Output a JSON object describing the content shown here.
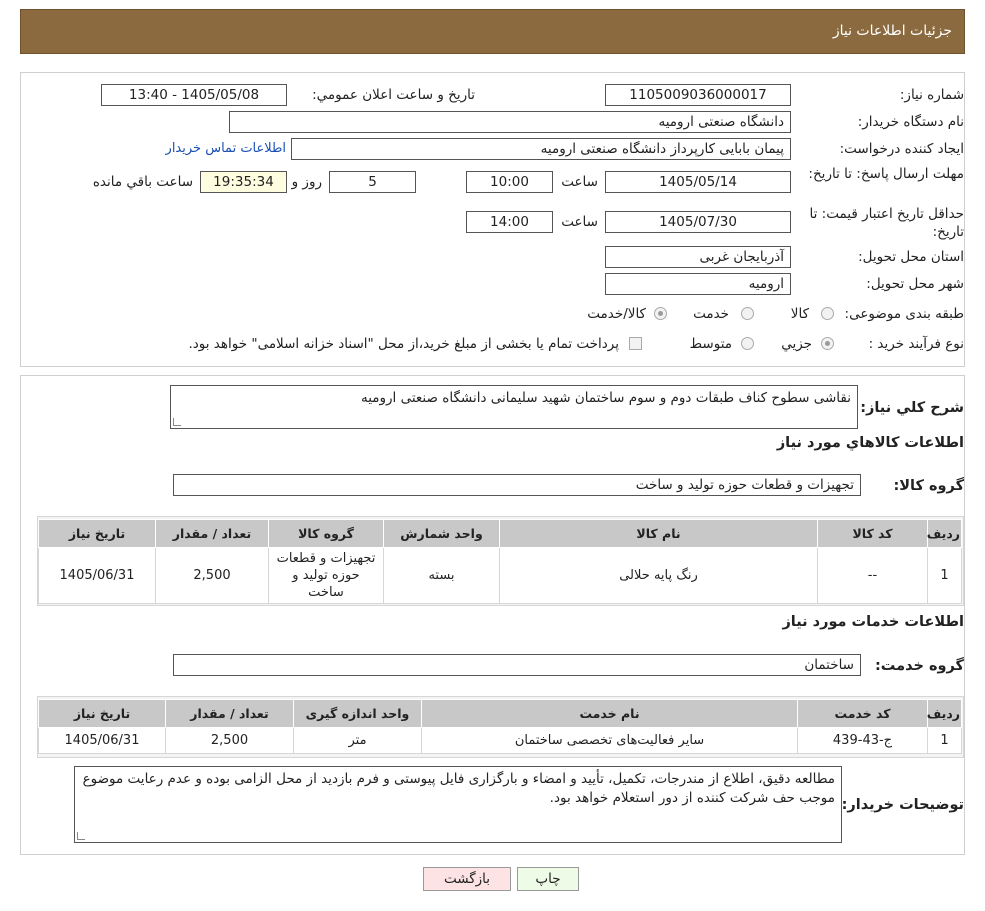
{
  "header": {
    "title": "جزئیات اطلاعات نیاز"
  },
  "form": {
    "need_number_label": "شماره نیاز:",
    "need_number": "1105009036000017",
    "announce_label": "تاریخ و ساعت اعلان عمومي:",
    "announce_value": "1405/05/08 - 13:40",
    "buyer_org_label": "نام دستگاه خریدار:",
    "buyer_org": "دانشگاه صنعتی ارومیه",
    "requester_label": "ایجاد کننده درخواست:",
    "requester": "پیمان بابایی کارپرداز دانشگاه صنعتی ارومیه",
    "contact_link": "اطلاعات تماس خریدار",
    "deadline_label": "مهلت ارسال پاسخ: تا تاریخ:",
    "deadline_date": "1405/05/14",
    "time_label": "ساعت",
    "deadline_time": "10:00",
    "days_value": "5",
    "days_label": "روز و",
    "remaining_time": "19:35:34",
    "remaining_label": "ساعت باقي مانده",
    "validity_label": "حداقل تاریخ اعتبار قیمت: تا تاریخ:",
    "validity_date": "1405/07/30",
    "validity_time": "14:00",
    "province_label": "استان محل تحویل:",
    "province": "آذربایجان غربی",
    "city_label": "شهر محل تحویل:",
    "city": "ارومیه",
    "category_label": "طبقه بندی موضوعی:",
    "category_options": [
      "کالا",
      "خدمت",
      "کالا/خدمت"
    ],
    "process_label": "نوع فرآیند خرید :",
    "process_options": [
      "جزیي",
      "متوسط"
    ],
    "payment_note": "پرداخت تمام یا بخشی از مبلغ خرید،از محل \"اسناد خزانه اسلامی\" خواهد بود."
  },
  "description": {
    "label": "شرح کلي نیاز:",
    "text": "نقاشی سطوح کناف طبقات دوم و سوم ساختمان شهید سلیمانی دانشگاه صنعتی ارومیه"
  },
  "goods": {
    "section_title": "اطلاعات کالاهاي مورد نیاز",
    "group_label": "گروه کالا:",
    "group_value": "تجهیزات و قطعات حوزه تولید و ساخت",
    "columns": [
      "ردیف",
      "کد کالا",
      "نام کالا",
      "واحد شمارش",
      "گروه کالا",
      "تعداد / مقدار",
      "تاریخ نیاز"
    ],
    "rows": [
      [
        "1",
        "--",
        "رنگ پایه حلالی",
        "بسته",
        "تجهیزات و قطعات حوزه تولید و ساخت",
        "2,500",
        "1405/06/31"
      ]
    ]
  },
  "services": {
    "section_title": "اطلاعات خدمات مورد نیاز",
    "group_label": "گروه خدمت:",
    "group_value": "ساختمان",
    "columns": [
      "ردیف",
      "کد خدمت",
      "نام خدمت",
      "واحد اندازه گیری",
      "تعداد / مقدار",
      "تاریخ نیاز"
    ],
    "rows": [
      [
        "1",
        "ج-43-439",
        "سایر فعالیت‌های تخصصی ساختمان",
        "متر",
        "2,500",
        "1405/06/31"
      ]
    ]
  },
  "buyer_notes": {
    "label": "توضیحات خریدار:",
    "text": "مطالعه دقیق، اطلاع از مندرجات، تکمیل، تأیید و امضاء و بارگزاری فایل پیوستی و فرم بازدید از محل الزامی بوده و عدم رعایت موضوع موجب حف شرکت کننده از دور استعلام خواهد بود."
  },
  "buttons": {
    "print": "چاپ",
    "back": "بازگشت"
  },
  "colors": {
    "header_bg": "#8b6a3f",
    "link": "#1a4fb3",
    "print_bg": "#eefbe6",
    "back_bg": "#fde3e3"
  }
}
